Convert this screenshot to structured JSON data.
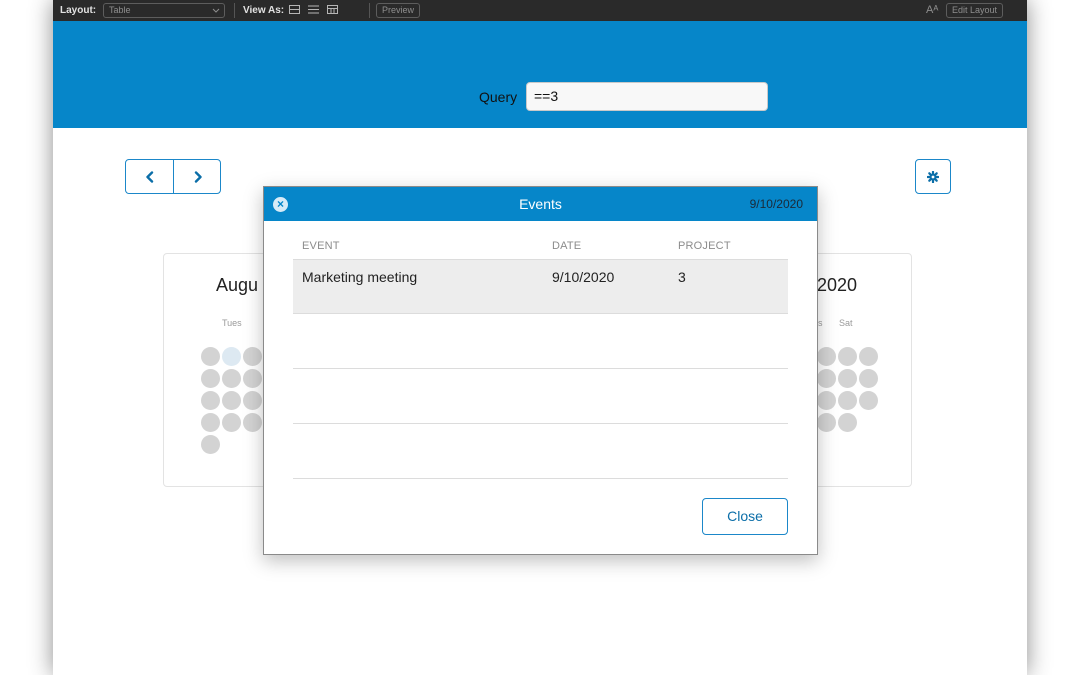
{
  "toolbar": {
    "layout_label": "Layout:",
    "layout_value": "Table",
    "view_as_label": "View As:",
    "preview_label": "Preview",
    "font_icon_glyph": "Aᴬ",
    "edit_layout_label": "Edit Layout",
    "icons": [
      "dropdown-chevron-icon",
      "form-view-icon",
      "list-view-icon",
      "table-view-icon",
      "font-size-icon"
    ]
  },
  "query": {
    "label": "Query",
    "value": "==3"
  },
  "nav": {
    "prev_icon": "chevron-left-icon",
    "next_icon": "chevron-right-icon",
    "settings_icon": "gear-icon"
  },
  "calendar": {
    "left_month": "Augu",
    "left_day_header": "Tues",
    "right_month": "2020",
    "right_day_headers": [
      "s",
      "Sat"
    ]
  },
  "modal": {
    "title": "Events",
    "date": "9/10/2020",
    "close_icon": "close-circle-icon",
    "columns": [
      "EVENT",
      "DATE",
      "PROJECT"
    ],
    "rows": [
      {
        "event": "Marketing meeting",
        "date": "9/10/2020",
        "project": "3"
      }
    ],
    "close_button": "Close"
  },
  "colors": {
    "brand_blue": "#0686c9",
    "toolbar_dark": "#2a2a2a",
    "selected_row": "#ededed",
    "day_dot": "#d3d3d3",
    "today_dot": "#dde9f2"
  }
}
